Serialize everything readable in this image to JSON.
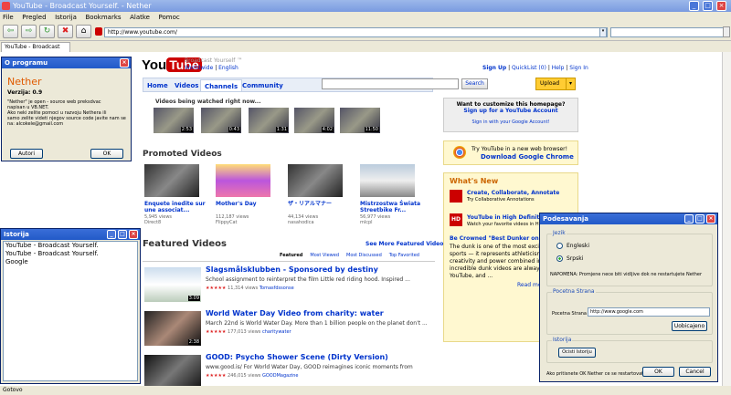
{
  "window": {
    "title": "YouTube - Broadcast Yourself. - Nether"
  },
  "menu": [
    "File",
    "Pregled",
    "Istorija",
    "Bookmarks",
    "Alatke",
    "Pomoc"
  ],
  "address": {
    "url": "http://www.youtube.com/"
  },
  "tab": {
    "label": "YouTube - Broadcast Yourself."
  },
  "status": "Gotovo",
  "yt": {
    "logo_you": "You",
    "logo_tube": "Tube",
    "tagline": "Broadcast Yourself ™",
    "region": "Worldwide",
    "lang": "English",
    "signup": "Sign Up",
    "quicklist": "QuickList (0)",
    "help": "Help",
    "signin": "Sign In",
    "nav": [
      "Home",
      "Videos",
      "Channels",
      "Community"
    ],
    "search_btn": "Search",
    "upload_btn": "Upload",
    "watched_title": "Videos being watched right now...",
    "watched_durations": [
      "2:53",
      "0:43",
      "1:31",
      "4:02",
      "11:50"
    ],
    "custom_box": {
      "q": "Want to customize this homepage?",
      "link": "Sign up for a YouTube Account",
      "signin": "Sign in with your Google Account!"
    },
    "chrome": {
      "text": "Try YouTube in a new web browser!",
      "link": "Download Google Chrome"
    },
    "promoted_title": "Promoted Videos",
    "promoted": [
      {
        "title": "Enquete inedite sur une associat...",
        "views": "5,945 views",
        "user": "Direct8"
      },
      {
        "title": "Mother's Day",
        "views": "112,187 views",
        "user": "FlippyCat"
      },
      {
        "title": "ザ・リアルマナー",
        "views": "44,134 views",
        "user": "nasahodica"
      },
      {
        "title": "Mistrzostwa Świata Streetbike Fr...",
        "views": "56,977 views",
        "user": "mlcpl"
      }
    ],
    "featured_title": "Featured Videos",
    "featured_all": "See More Featured Videos",
    "featured_tabs": [
      "Featured",
      "Most Viewed",
      "Most Discussed",
      "Top Favorited"
    ],
    "featured": [
      {
        "title": "Slagsmålsklubben - Sponsored by destiny",
        "desc": "School assignment to reinterpret the film Little red riding hood. Inspired ...",
        "views": "11,314 views",
        "user": "Tomasfdssonse",
        "dur": "3:09"
      },
      {
        "title": "World Water Day Video from charity: water",
        "desc": "March 22nd is World Water Day. More than 1 billion people on the planet don't ...",
        "views": "177,013 views",
        "user": "charitywater",
        "dur": "2:38"
      },
      {
        "title": "GOOD: Psycho Shower Scene (Dirty Version)",
        "desc": "www.good.is/ For World Water Day, GOOD reimagines iconic moments from",
        "views": "246,015 views",
        "user": "GOODMagazine",
        "dur": ""
      }
    ],
    "whatsnew": {
      "title": "What's New",
      "items": [
        {
          "title": "Create, Collaborate, Annotate",
          "desc": "Try Collaborative Annotations"
        },
        {
          "title": "YouTube in High Definition",
          "desc": "Watch your favorite videos in HD"
        }
      ],
      "feature": "Be Crowned \"Best Dunker on YouTube\"",
      "feature_desc": [
        "The dunk is one of the most exciting",
        "sports — it represents athleticism,",
        "creativity and power combined in one",
        "incredible dunk videos are always p",
        "YouTube, and ..."
      ],
      "readmore": "Read mo..."
    }
  },
  "about": {
    "title": "O programu",
    "name": "Nether",
    "version": "Verzija: 0.9",
    "text": [
      "\"Nether\" je open - source web preksdvac",
      "napisan u VB.NET.",
      "Ako neki zelite pomoci u razvoju Nethera ili",
      "samo zelite videti njegov source code javite nam se",
      "na: alcokele@gmail.com"
    ],
    "btn_authors": "Autori",
    "btn_ok": "OK"
  },
  "history": {
    "title": "Istorija",
    "items": [
      "YouTube - Broadcast Yourself.",
      "YouTube - Broadcast Yourself.",
      "Google"
    ]
  },
  "settings": {
    "title": "Podesavanja",
    "lang_group": "Jezik",
    "lang_en": "Engleski",
    "lang_sr": "Srpski",
    "note": "NAPOMENA: Promjene nece biti vidljive dok ne restartujete Nether",
    "home_group": "Pocetna Strana",
    "home_label": "Pocetna Strana",
    "home_value": "http://www.google.com",
    "default_btn": "Uobicajeno",
    "hist_group": "Istorija",
    "hist_btn": "Ocisti Istoriju",
    "footer": "Ako pritisnete OK Nether ce se restartovati",
    "ok": "OK",
    "cancel": "Cancel"
  },
  "colors": {
    "accent": "#225ac8",
    "yt_red": "#cc0000",
    "link": "#0033cc"
  }
}
